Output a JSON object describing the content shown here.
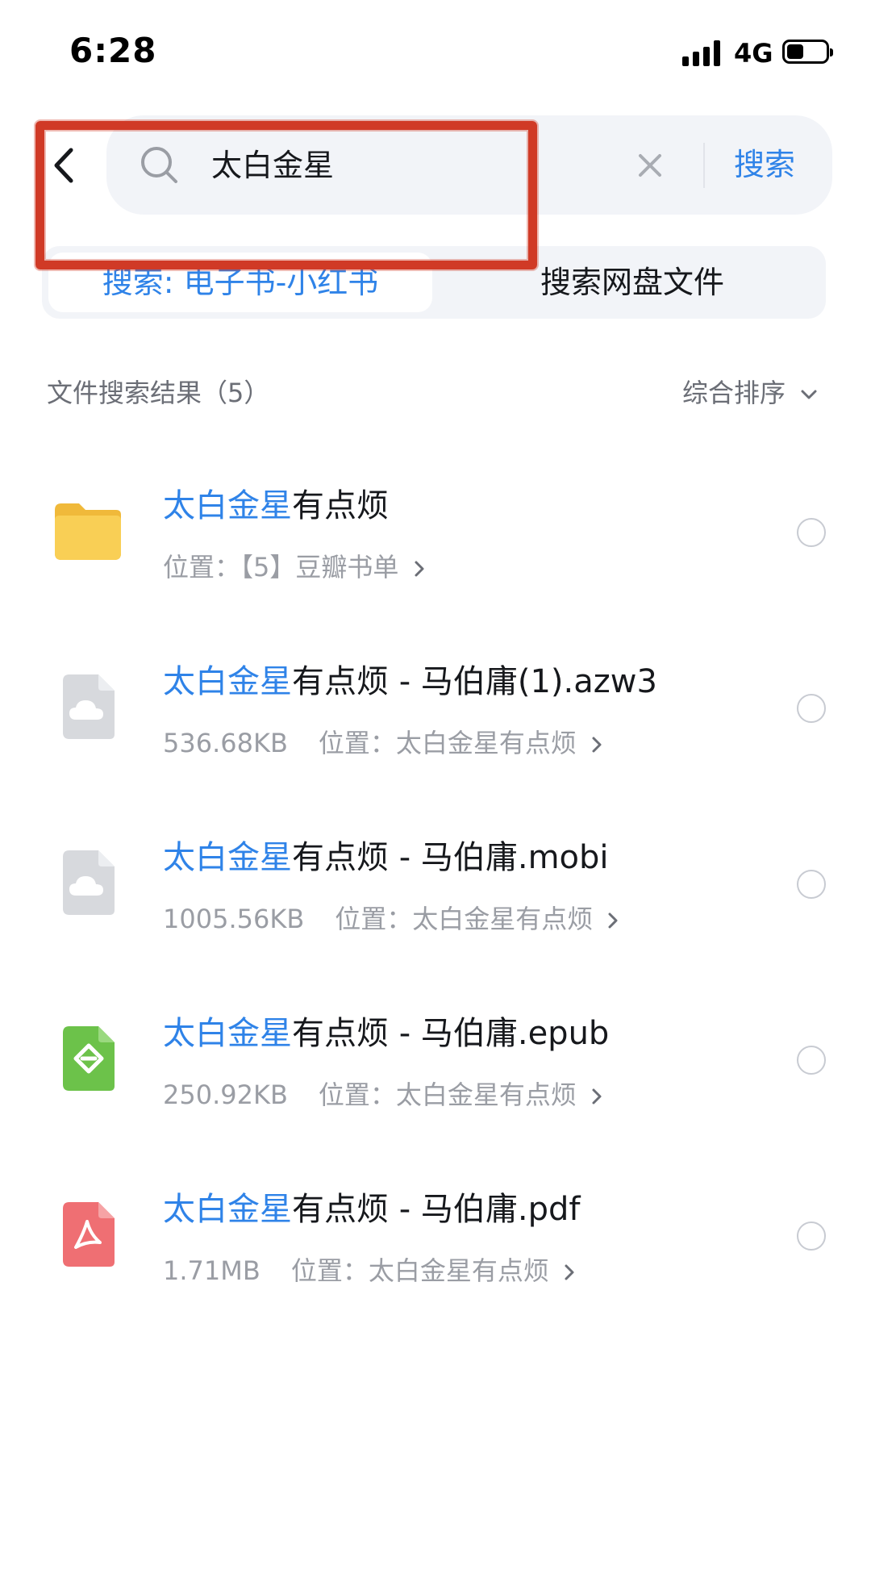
{
  "status_bar": {
    "time": "6:28",
    "network": "4G"
  },
  "search": {
    "query": "太白金星",
    "submit_label": "搜索"
  },
  "scope_tabs": [
    {
      "label": "搜索: 电子书-小红书",
      "active": true
    },
    {
      "label": "搜索网盘文件",
      "active": false
    }
  ],
  "results": {
    "title": "文件搜索结果（5）",
    "sort_label": "综合排序",
    "items": [
      {
        "type": "folder",
        "icon": "folder-icon",
        "name_highlight": "太白金星",
        "name_rest": "有点烦",
        "size": "",
        "location_label": "位置：",
        "location": "【5】豆瓣书单"
      },
      {
        "type": "azw3",
        "icon": "cloud-file-icon",
        "name_highlight": "太白金星",
        "name_rest": "有点烦 - 马伯庸(1).azw3",
        "size": "536.68KB",
        "location_label": "位置：",
        "location": "太白金星有点烦"
      },
      {
        "type": "mobi",
        "icon": "cloud-file-icon",
        "name_highlight": "太白金星",
        "name_rest": "有点烦 - 马伯庸.mobi",
        "size": "1005.56KB",
        "location_label": "位置：",
        "location": "太白金星有点烦"
      },
      {
        "type": "epub",
        "icon": "epub-icon",
        "name_highlight": "太白金星",
        "name_rest": "有点烦 - 马伯庸.epub",
        "size": "250.92KB",
        "location_label": "位置：",
        "location": "太白金星有点烦"
      },
      {
        "type": "pdf",
        "icon": "pdf-icon",
        "name_highlight": "太白金星",
        "name_rest": "有点烦 - 马伯庸.pdf",
        "size": "1.71MB",
        "location_label": "位置：",
        "location": "太白金星有点烦"
      }
    ]
  },
  "colors": {
    "accent": "#2f83e8",
    "annotation": "#d03a26",
    "folder": "#f7c84a",
    "epub": "#6cc24a",
    "pdf": "#ef6f73"
  }
}
